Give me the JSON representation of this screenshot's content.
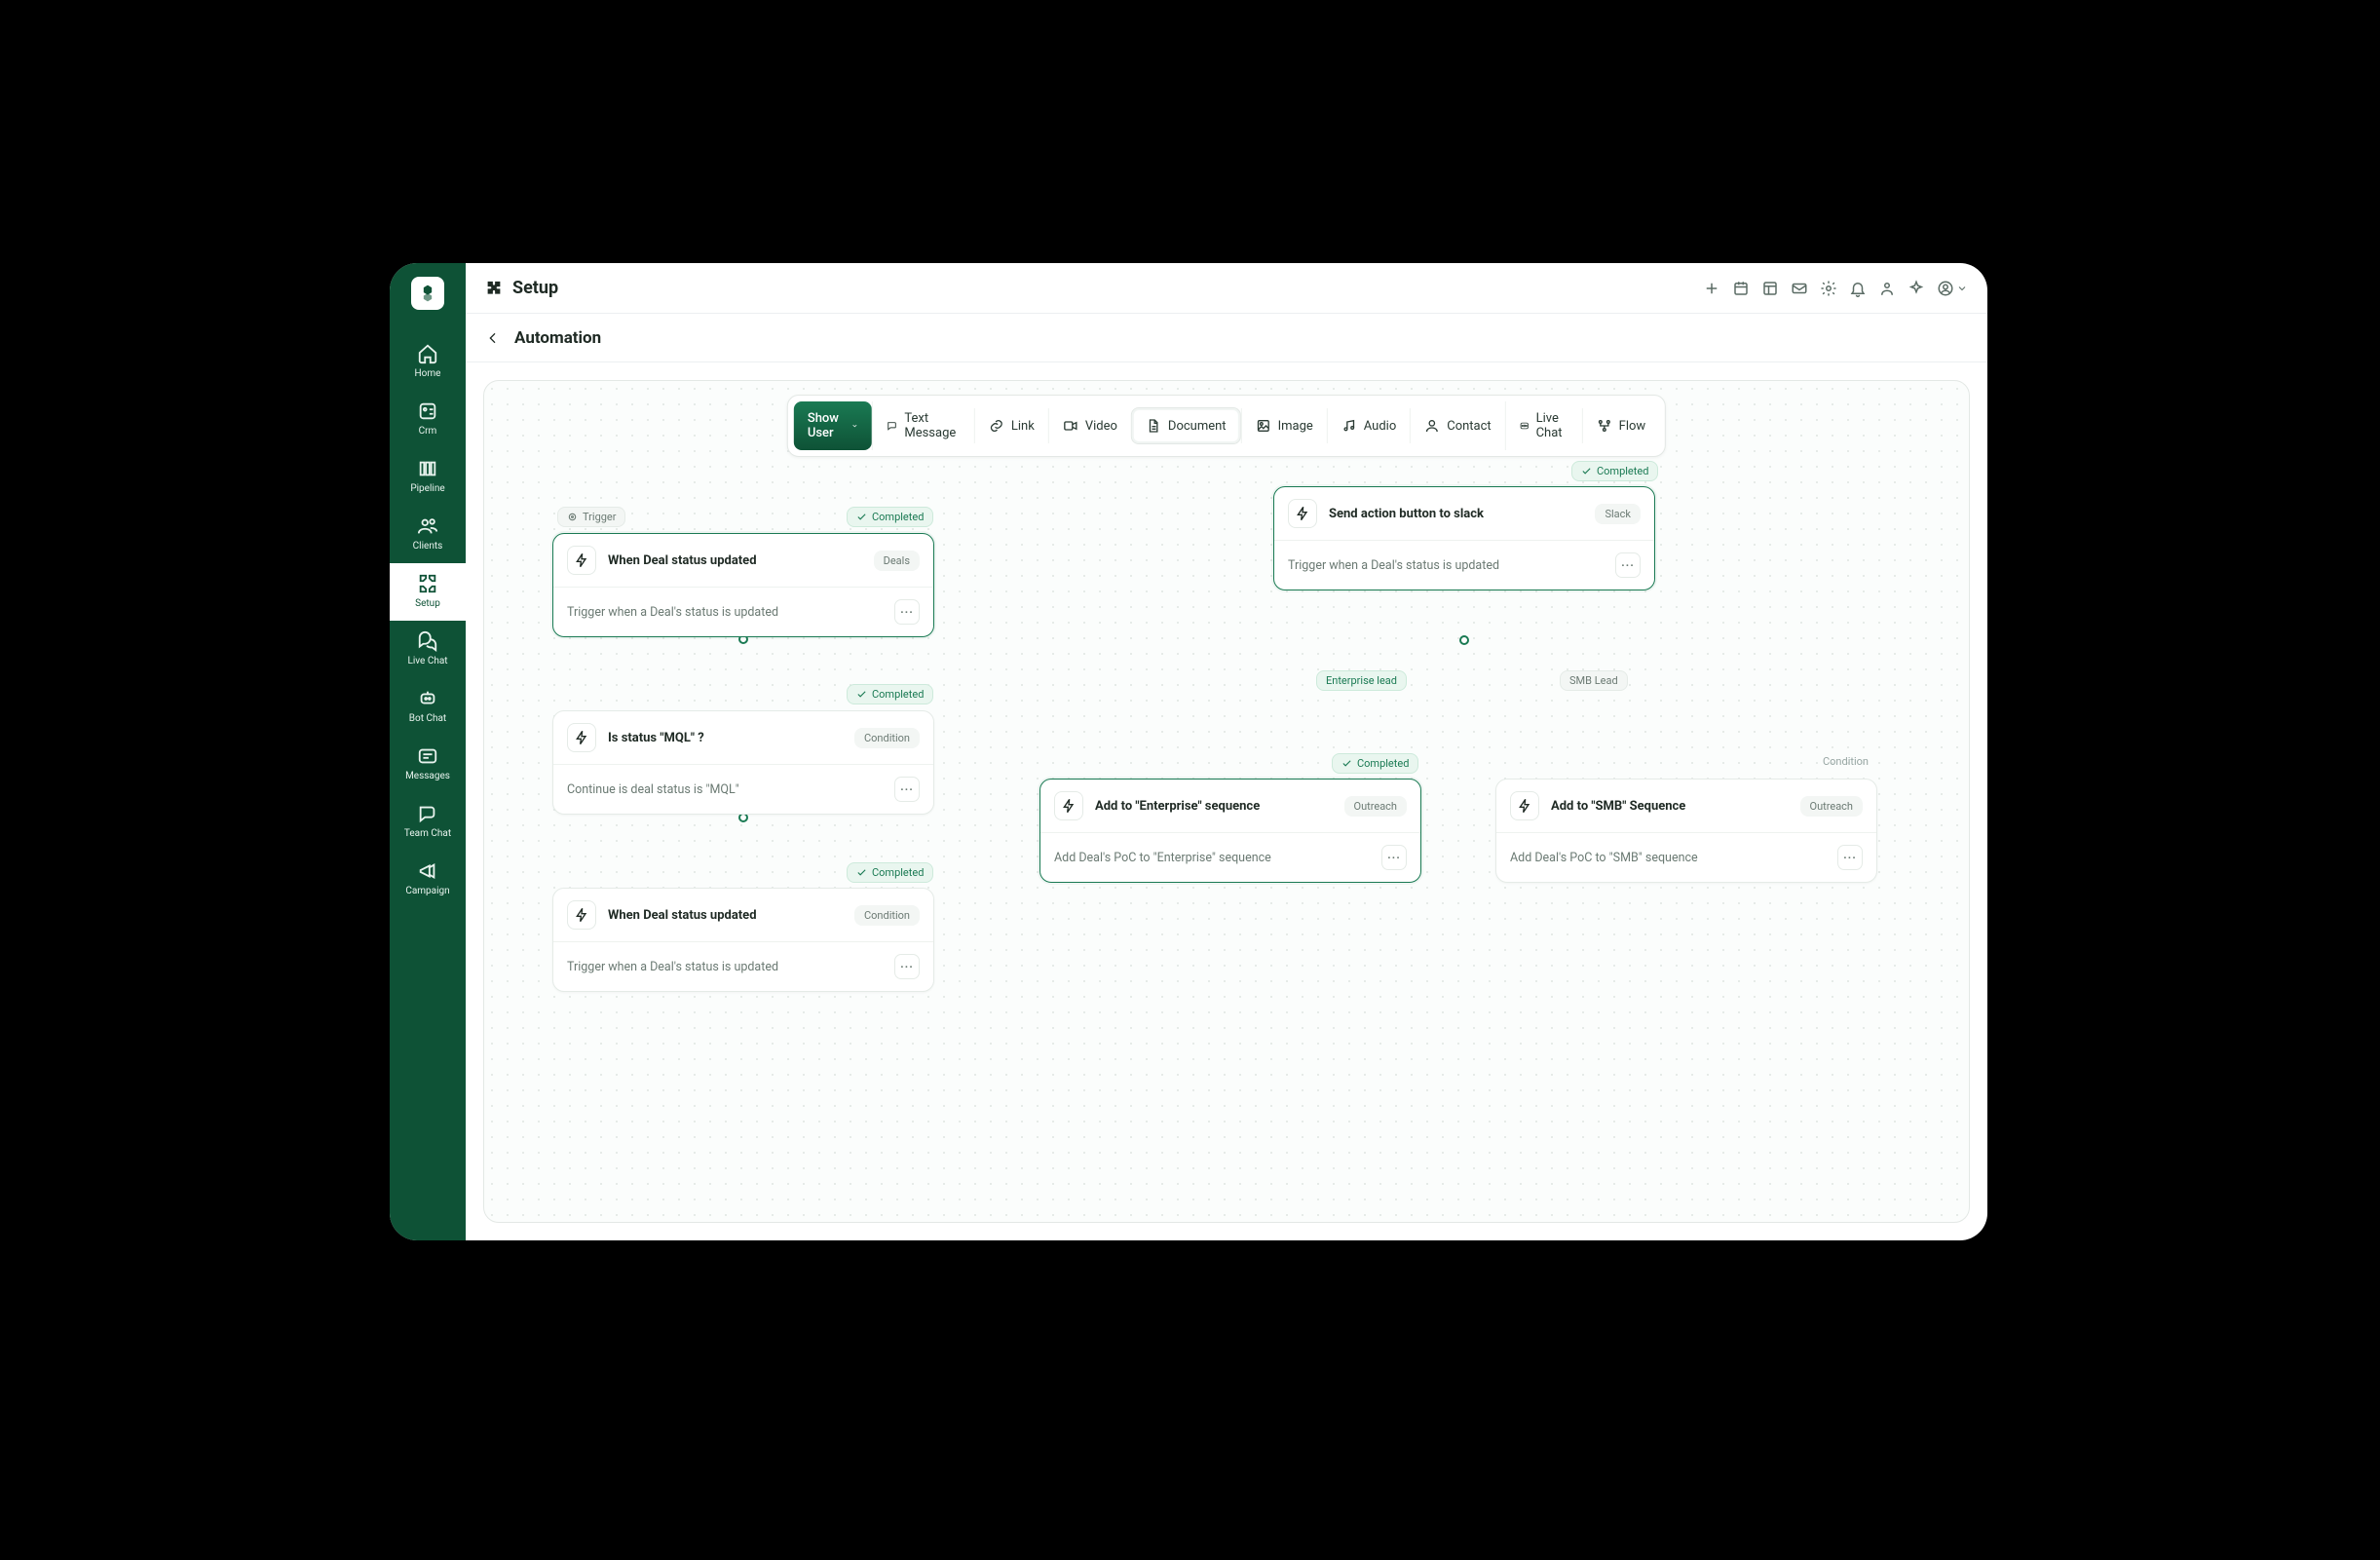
{
  "sidebar": {
    "items": [
      {
        "label": "Home"
      },
      {
        "label": "Crm"
      },
      {
        "label": "Pipeline"
      },
      {
        "label": "Clients"
      },
      {
        "label": "Setup"
      },
      {
        "label": "Live Chat"
      },
      {
        "label": "Bot Chat"
      },
      {
        "label": "Messages"
      },
      {
        "label": "Team Chat"
      },
      {
        "label": "Campaign"
      }
    ]
  },
  "header": {
    "title": "Setup"
  },
  "subheader": {
    "title": "Automation"
  },
  "toolbar": {
    "dropdown_label": "Show User",
    "items": [
      {
        "label": "Text Message"
      },
      {
        "label": "Link"
      },
      {
        "label": "Video"
      },
      {
        "label": "Document"
      },
      {
        "label": "Image"
      },
      {
        "label": "Audio"
      },
      {
        "label": "Contact"
      },
      {
        "label": "Live Chat"
      },
      {
        "label": "Flow"
      }
    ]
  },
  "badges": {
    "trigger": "Trigger",
    "completed": "Completed",
    "condition": "Condition",
    "enterprise": "Enterprise lead",
    "smb": "SMB Lead"
  },
  "nodes": {
    "n1": {
      "title": "When Deal status updated",
      "tag": "Deals",
      "desc": "Trigger when a Deal's status is updated"
    },
    "n2": {
      "title": "Is status \"MQL\" ?",
      "tag": "Condition",
      "desc": "Continue is deal status is \"MQL\""
    },
    "n3": {
      "title": "When Deal status updated",
      "tag": "Condition",
      "desc": "Trigger when a Deal's status is updated"
    },
    "n4": {
      "title": "Send action button to slack",
      "tag": "Slack",
      "desc": "Trigger when a Deal's status is updated"
    },
    "n5": {
      "title": "Add to \"Enterprise\" sequence",
      "tag": "Outreach",
      "desc": "Add Deal's PoC to \"Enterprise\" sequence"
    },
    "n6": {
      "title": "Add to \"SMB\" Sequence",
      "tag": "Outreach",
      "desc": "Add Deal's PoC to \"SMB\" sequence"
    }
  }
}
